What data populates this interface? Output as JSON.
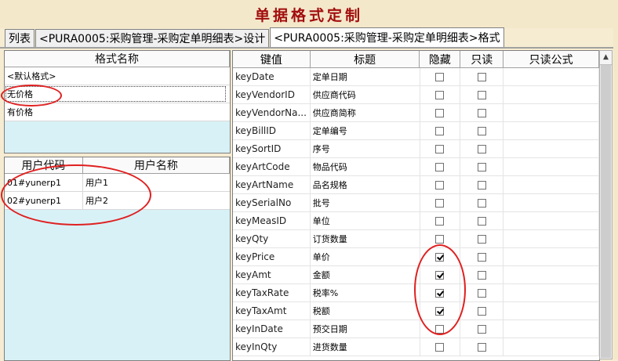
{
  "window": {
    "title": "单据格式定制"
  },
  "tabs": [
    {
      "label": "列表"
    },
    {
      "label": "<PURA0005:采购管理-采购定单明细表>设计"
    },
    {
      "label": "<PURA0005:采购管理-采购定单明细表>格式"
    }
  ],
  "formats": {
    "header": "格式名称",
    "items": [
      "<默认格式>",
      "无价格",
      "有价格"
    ]
  },
  "users": {
    "headers": [
      "用户代码",
      "用户名称"
    ],
    "rows": [
      {
        "code": "01#yunerp1",
        "name": "用户1"
      },
      {
        "code": "02#yunerp1",
        "name": "用户2"
      }
    ]
  },
  "fields": {
    "headers": [
      "键值",
      "标题",
      "隐藏",
      "只读",
      "只读公式"
    ],
    "rows": [
      {
        "key": "keyDate",
        "title": "定单日期",
        "hidden": false,
        "readonly": false
      },
      {
        "key": "keyVendorID",
        "title": "供应商代码",
        "hidden": false,
        "readonly": false
      },
      {
        "key": "keyVendorNa...",
        "title": "供应商简称",
        "hidden": false,
        "readonly": false
      },
      {
        "key": "keyBillID",
        "title": "定单编号",
        "hidden": false,
        "readonly": false
      },
      {
        "key": "keySortID",
        "title": "序号",
        "hidden": false,
        "readonly": false
      },
      {
        "key": "keyArtCode",
        "title": "物品代码",
        "hidden": false,
        "readonly": false
      },
      {
        "key": "keyArtName",
        "title": "品名规格",
        "hidden": false,
        "readonly": false
      },
      {
        "key": "keySerialNo",
        "title": "批号",
        "hidden": false,
        "readonly": false
      },
      {
        "key": "keyMeasID",
        "title": "单位",
        "hidden": false,
        "readonly": false
      },
      {
        "key": "keyQty",
        "title": "订货数量",
        "hidden": false,
        "readonly": false
      },
      {
        "key": "keyPrice",
        "title": "单价",
        "hidden": true,
        "readonly": false
      },
      {
        "key": "keyAmt",
        "title": "金额",
        "hidden": true,
        "readonly": false
      },
      {
        "key": "keyTaxRate",
        "title": "税率%",
        "hidden": true,
        "readonly": false
      },
      {
        "key": "keyTaxAmt",
        "title": "税额",
        "hidden": true,
        "readonly": false
      },
      {
        "key": "keyInDate",
        "title": "预交日期",
        "hidden": false,
        "readonly": false
      },
      {
        "key": "keyInQty",
        "title": "进货数量",
        "hidden": false,
        "readonly": false
      }
    ]
  },
  "scrollbar": {
    "up_arrow": "▲"
  },
  "annotation_color": "#e02020"
}
